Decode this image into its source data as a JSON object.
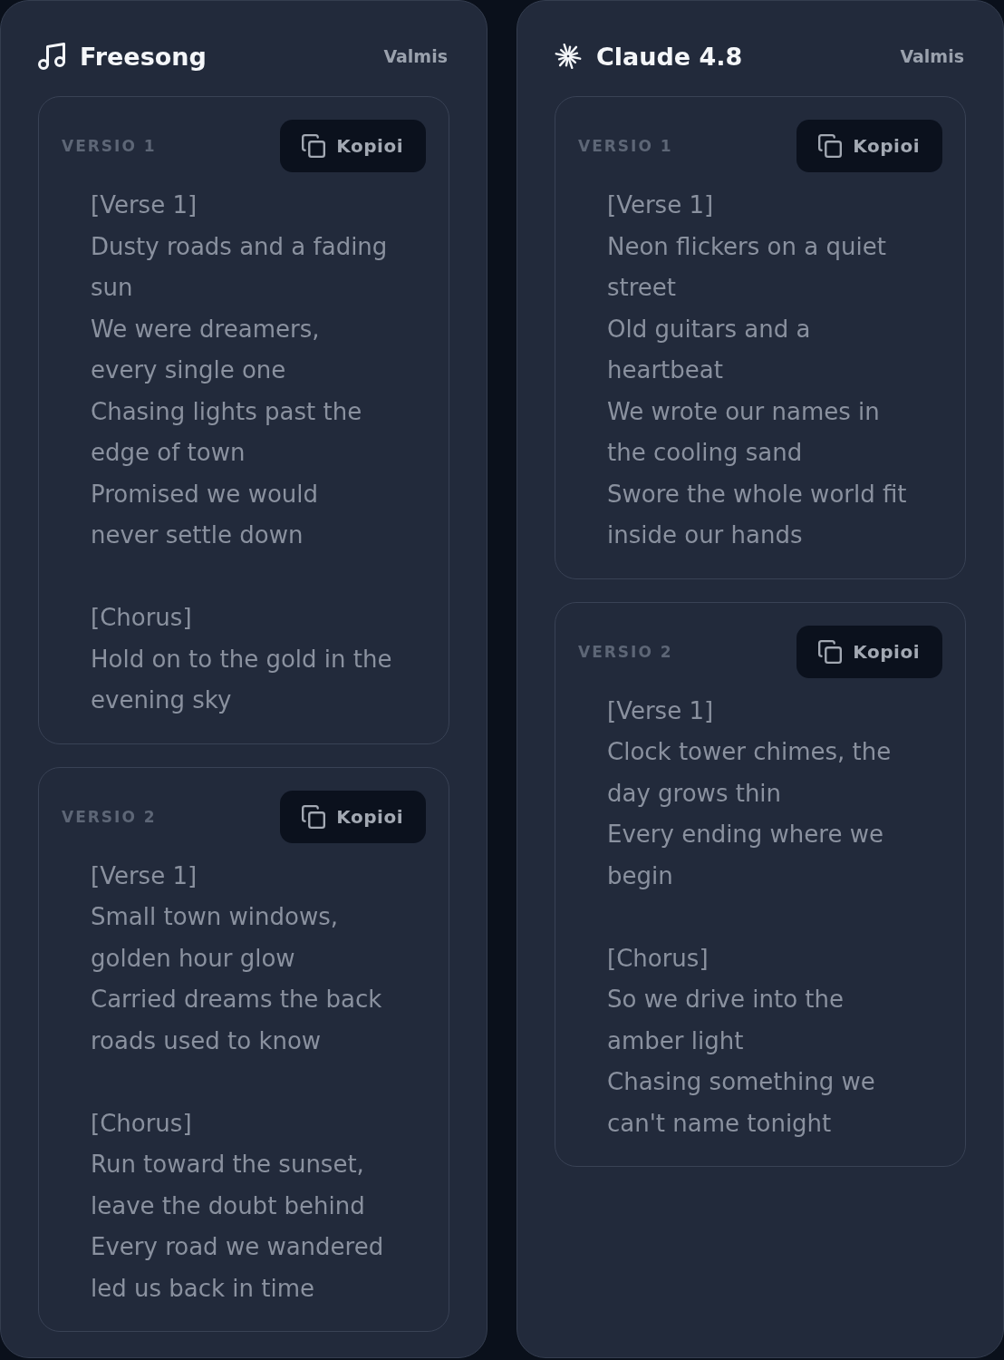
{
  "panels": [
    {
      "kind": "music",
      "model": "Freesong",
      "status": "Valmis",
      "versions": [
        {
          "label": "VERSIO 1",
          "copy_button": "Kopioi",
          "sections": [
            {
              "tag": "[Verse 1]",
              "lines": [
                "Dusty roads and a fading sun",
                "We were dreamers, every single one",
                "Chasing lights past the edge of town",
                "Promised we would never settle down"
              ]
            },
            {
              "tag": "[Chorus]",
              "lines": [
                "Hold on to the gold in the evening sky"
              ]
            }
          ]
        },
        {
          "label": "VERSIO 2",
          "copy_button": "Kopioi",
          "sections": [
            {
              "tag": "[Verse 1]",
              "lines": [
                "Small town windows, golden hour glow",
                "Carried dreams the back roads used to know"
              ]
            },
            {
              "tag": "[Chorus]",
              "lines": [
                "Run toward the sunset, leave the doubt behind",
                "Every road we wandered led us back in time"
              ]
            }
          ]
        }
      ]
    },
    {
      "kind": "spark",
      "model": "Claude 4.8",
      "status": "Valmis",
      "versions": [
        {
          "label": "VERSIO 1",
          "copy_button": "Kopioi",
          "sections": [
            {
              "tag": "[Verse 1]",
              "lines": [
                "Neon flickers on a quiet street",
                "Old guitars and a heartbeat",
                "We wrote our names in the cooling sand",
                "Swore the whole world fit inside our hands"
              ]
            }
          ]
        },
        {
          "label": "VERSIO 2",
          "copy_button": "Kopioi",
          "sections": [
            {
              "tag": "[Verse 1]",
              "lines": [
                "Clock tower chimes, the day grows thin",
                "Every ending where we begin"
              ]
            },
            {
              "tag": "[Chorus]",
              "lines": [
                "So we drive into the amber light",
                "Chasing something we can't name tonight"
              ]
            }
          ]
        }
      ]
    }
  ]
}
